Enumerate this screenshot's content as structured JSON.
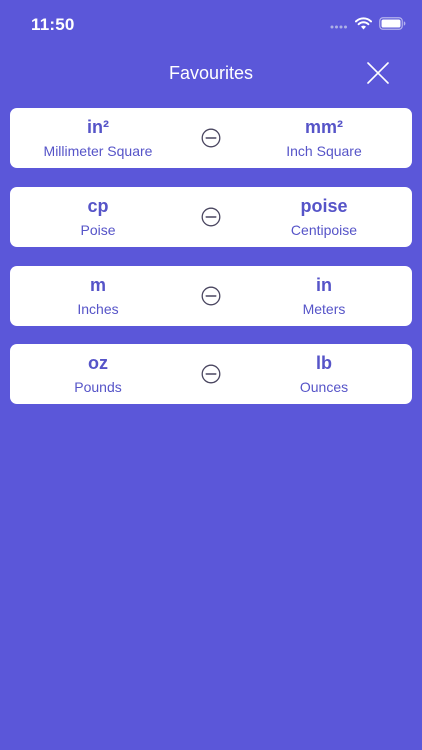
{
  "status_bar": {
    "time": "11:50",
    "icons": [
      "signal-icon",
      "wifi-icon",
      "battery-icon"
    ]
  },
  "header": {
    "title": "Favourites",
    "close_icon": "close-icon"
  },
  "colors": {
    "background": "#5b57d9",
    "card": "#ffffff",
    "accent_text": "#5654c8",
    "remove_icon": "#4a4660"
  },
  "favourites": [
    {
      "left_symbol": "in²",
      "left_name": "Millimeter Square",
      "right_symbol": "mm²",
      "right_name": "Inch Square",
      "remove_icon": "minus-circle-icon"
    },
    {
      "left_symbol": "cp",
      "left_name": "Poise",
      "right_symbol": "poise",
      "right_name": "Centipoise",
      "remove_icon": "minus-circle-icon"
    },
    {
      "left_symbol": "m",
      "left_name": "Inches",
      "right_symbol": "in",
      "right_name": "Meters",
      "remove_icon": "minus-circle-icon"
    },
    {
      "left_symbol": "oz",
      "left_name": "Pounds",
      "right_symbol": "lb",
      "right_name": "Ounces",
      "remove_icon": "minus-circle-icon"
    }
  ]
}
